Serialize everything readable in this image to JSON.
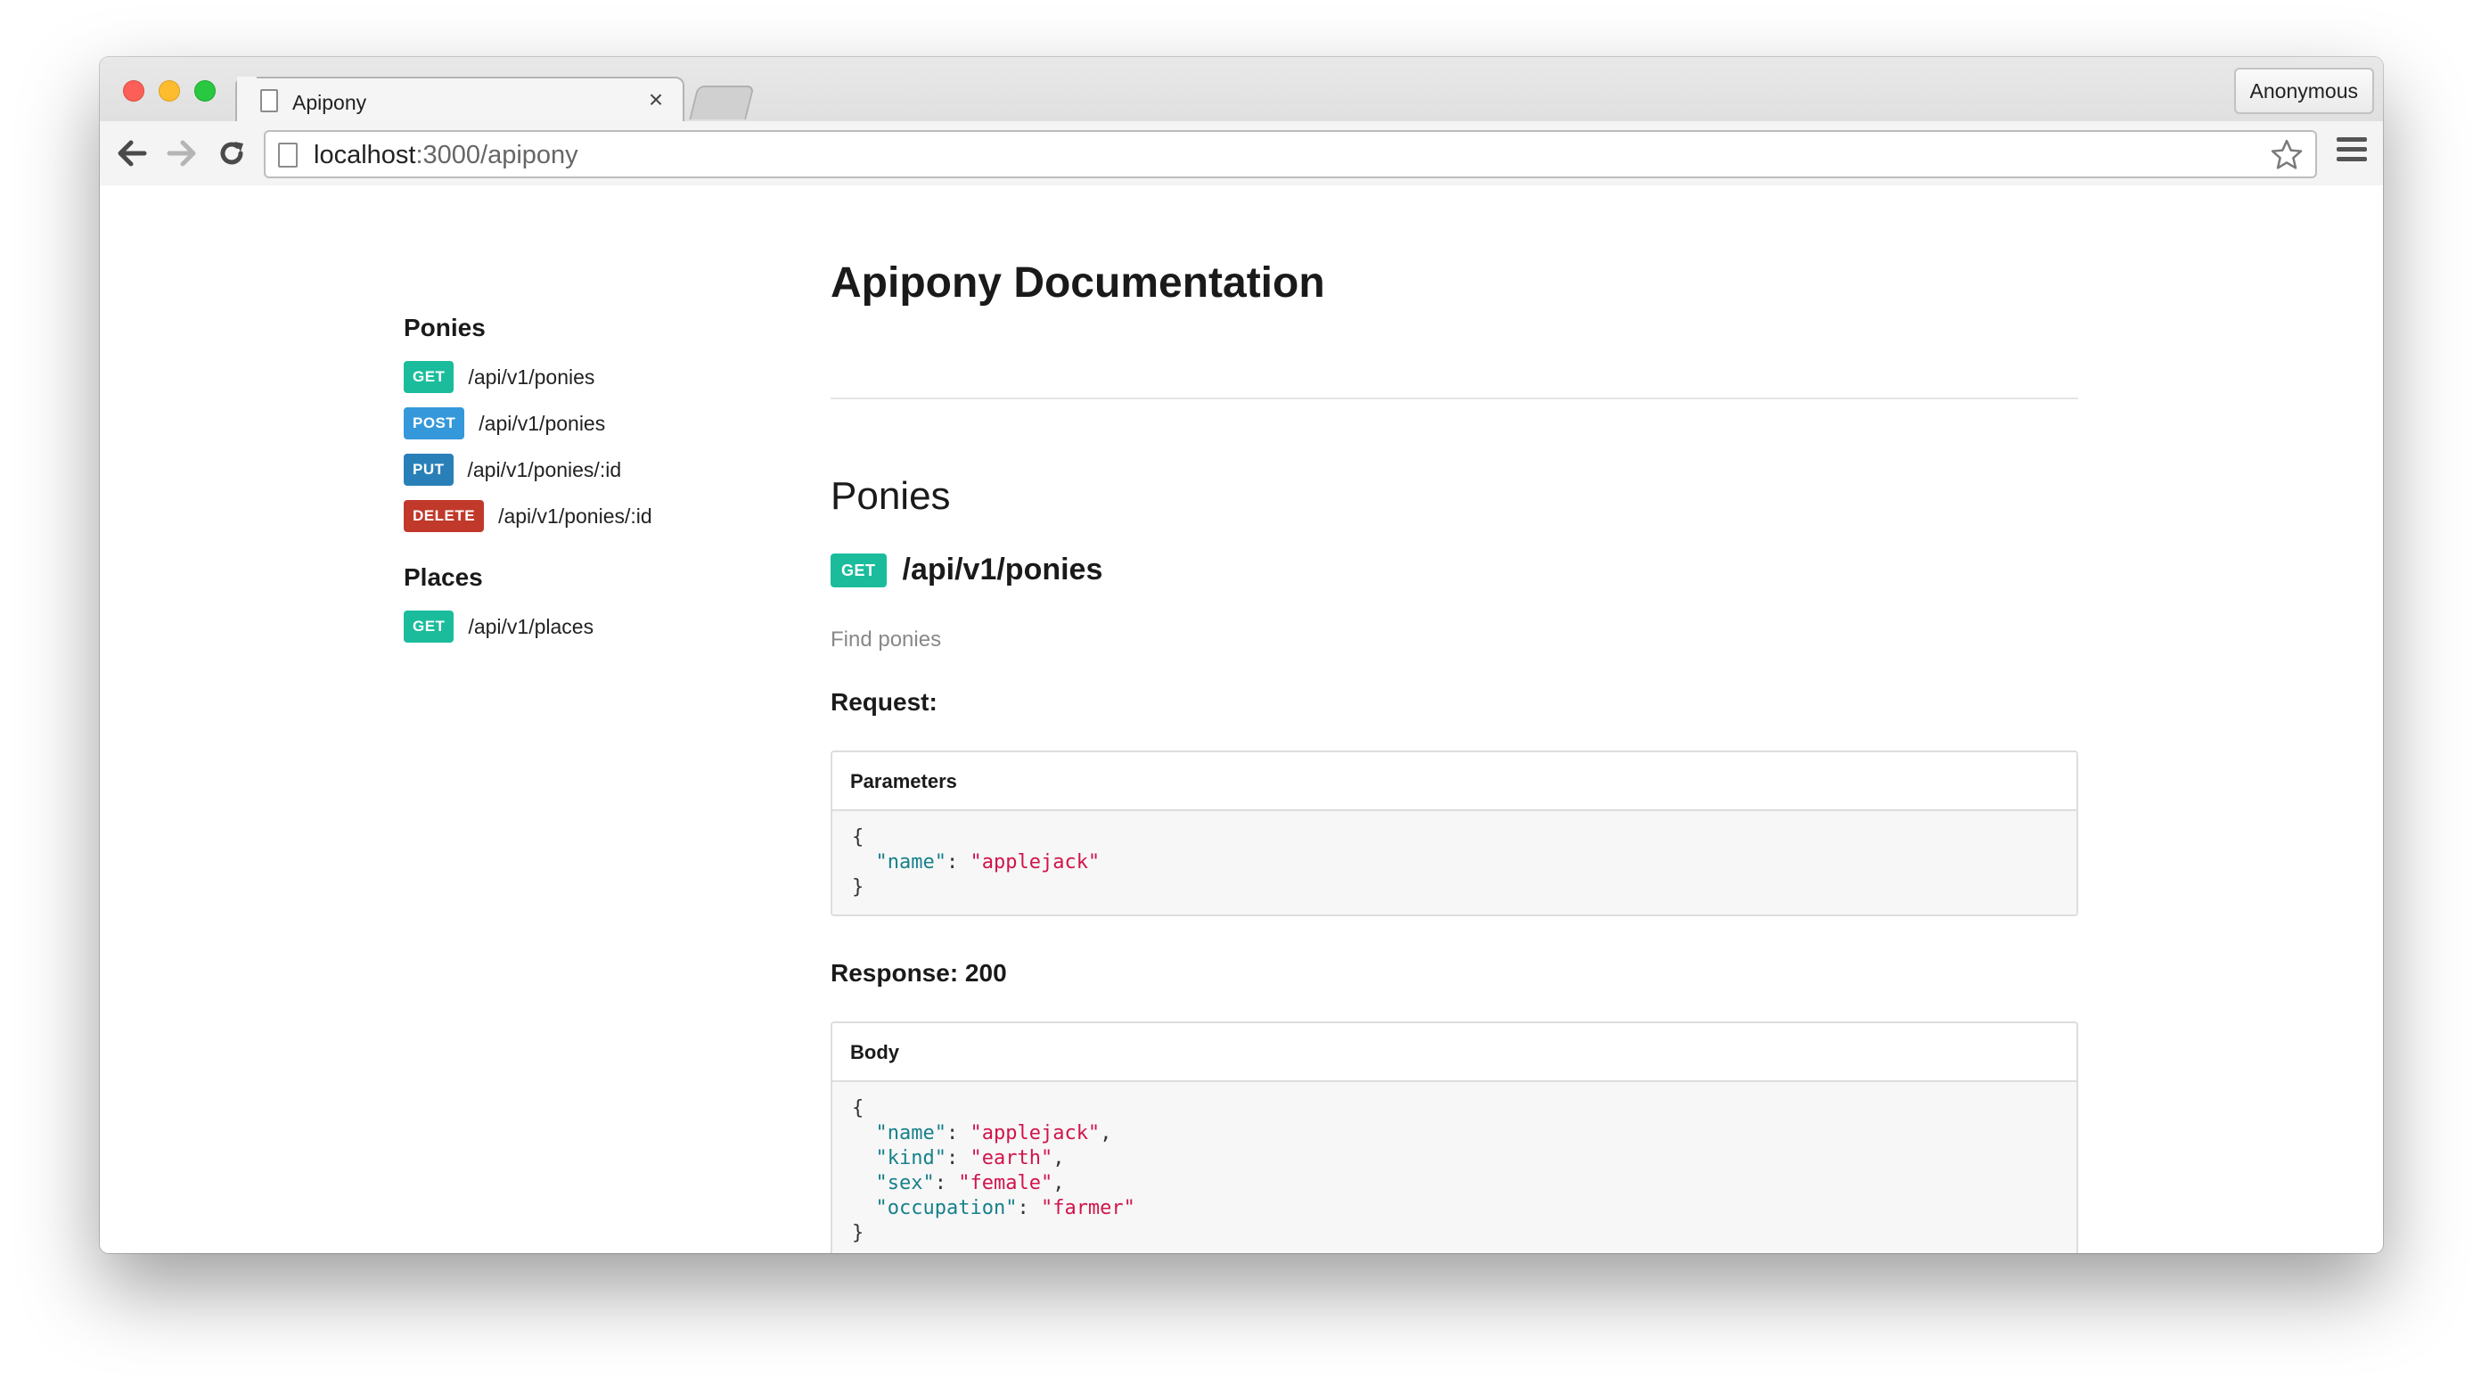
{
  "browser": {
    "tab_title": "Apipony",
    "tab_close": "×",
    "profile_label": "Anonymous",
    "url_host": "localhost",
    "url_rest": ":3000/apipony",
    "icons": {
      "back": "back-arrow-icon",
      "forward": "forward-arrow-icon",
      "reload": "reload-icon",
      "star": "star-icon",
      "menu": "hamburger-menu-icon",
      "page": "page-icon"
    }
  },
  "sidebar": {
    "sections": [
      {
        "heading": "Ponies",
        "items": [
          {
            "method": "GET",
            "path": "/api/v1/ponies"
          },
          {
            "method": "POST",
            "path": "/api/v1/ponies"
          },
          {
            "method": "PUT",
            "path": "/api/v1/ponies/:id"
          },
          {
            "method": "DELETE",
            "path": "/api/v1/ponies/:id"
          }
        ]
      },
      {
        "heading": "Places",
        "items": [
          {
            "method": "GET",
            "path": "/api/v1/places"
          }
        ]
      }
    ]
  },
  "main": {
    "title": "Apipony Documentation",
    "section_title": "Ponies",
    "endpoint": {
      "method": "GET",
      "path": "/api/v1/ponies",
      "description": "Find ponies"
    },
    "request_label": "Request:",
    "parameters": {
      "header": "Parameters",
      "open": "{",
      "close": "}",
      "fields": [
        {
          "key": "\"name\"",
          "value": "\"applejack\"",
          "sep": ""
        }
      ]
    },
    "response_label": "Response: 200",
    "body": {
      "header": "Body",
      "open": "{",
      "close": "}",
      "fields": [
        {
          "key": "\"name\"",
          "value": "\"applejack\"",
          "sep": ","
        },
        {
          "key": "\"kind\"",
          "value": "\"earth\"",
          "sep": ","
        },
        {
          "key": "\"sex\"",
          "value": "\"female\"",
          "sep": ","
        },
        {
          "key": "\"occupation\"",
          "value": "\"farmer\"",
          "sep": ""
        }
      ]
    }
  },
  "colors": {
    "get": "#1abc9c",
    "post": "#3498db",
    "put": "#2980b9",
    "delete": "#c0392b",
    "json_key": "#16808b",
    "json_value": "#d1144a"
  }
}
